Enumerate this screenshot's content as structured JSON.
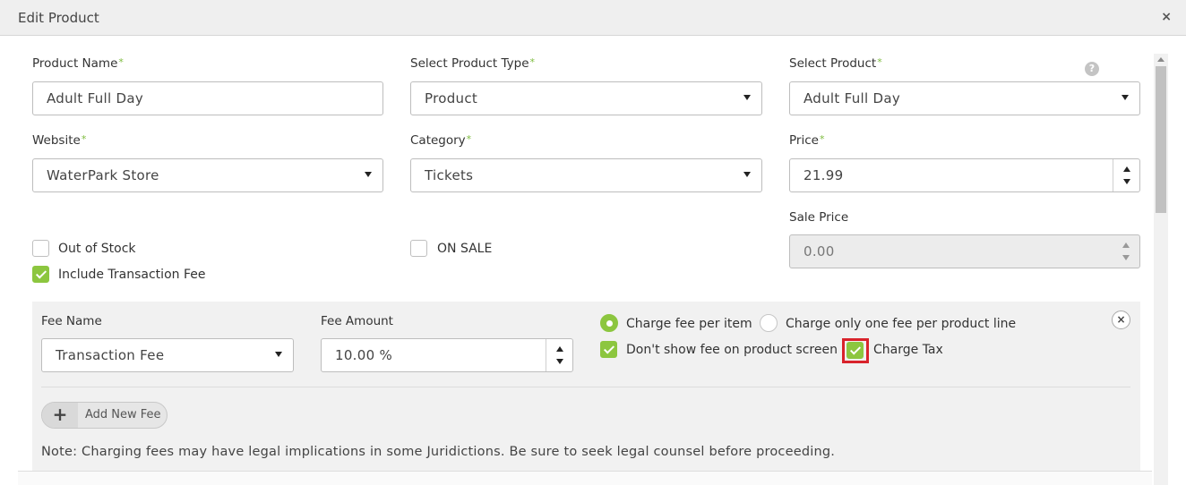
{
  "dialog": {
    "title": "Edit Product",
    "close_label": "×"
  },
  "fields": {
    "product_name": {
      "label": "Product Name",
      "value": "Adult Full Day"
    },
    "product_type": {
      "label": "Select Product Type",
      "value": "Product"
    },
    "select_product": {
      "label": "Select Product",
      "value": "Adult Full Day"
    },
    "website": {
      "label": "Website",
      "value": "WaterPark Store"
    },
    "category": {
      "label": "Category",
      "value": "Tickets"
    },
    "price": {
      "label": "Price",
      "value": "21.99"
    },
    "sale_price": {
      "label": "Sale Price",
      "value": "0.00"
    },
    "required_mark": "*"
  },
  "help_icon": "?",
  "checkboxes": {
    "out_of_stock": {
      "label": "Out of Stock",
      "checked": false
    },
    "on_sale": {
      "label": "ON SALE",
      "checked": false
    },
    "include_fee": {
      "label": "Include Transaction Fee",
      "checked": true
    }
  },
  "fee": {
    "name_label": "Fee Name",
    "name_value": "Transaction Fee",
    "amount_label": "Fee Amount",
    "amount_value": "10.00 %",
    "radio_per_item": "Charge fee per item",
    "radio_per_line": "Charge only one fee per product line",
    "dont_show": "Don't show fee on product screen",
    "charge_tax": "Charge Tax",
    "remove_label": "×",
    "add_plus": "+",
    "add_label": "Add New Fee",
    "note": "Note: Charging fees may have legal implications in some Juridictions. Be sure to seek legal counsel before proceeding."
  },
  "colors": {
    "accent": "#8cc63f",
    "highlight": "#d9232b"
  }
}
